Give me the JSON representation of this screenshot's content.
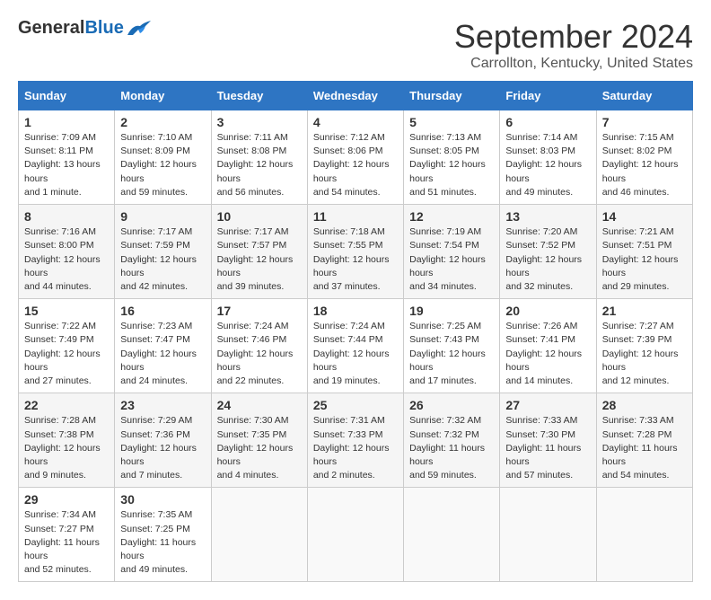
{
  "header": {
    "logo_general": "General",
    "logo_blue": "Blue",
    "title": "September 2024",
    "location": "Carrollton, Kentucky, United States"
  },
  "days_of_week": [
    "Sunday",
    "Monday",
    "Tuesday",
    "Wednesday",
    "Thursday",
    "Friday",
    "Saturday"
  ],
  "weeks": [
    [
      {
        "day": "1",
        "sunrise": "Sunrise: 7:09 AM",
        "sunset": "Sunset: 8:11 PM",
        "daylight": "Daylight: 13 hours and 1 minute."
      },
      {
        "day": "2",
        "sunrise": "Sunrise: 7:10 AM",
        "sunset": "Sunset: 8:09 PM",
        "daylight": "Daylight: 12 hours and 59 minutes."
      },
      {
        "day": "3",
        "sunrise": "Sunrise: 7:11 AM",
        "sunset": "Sunset: 8:08 PM",
        "daylight": "Daylight: 12 hours and 56 minutes."
      },
      {
        "day": "4",
        "sunrise": "Sunrise: 7:12 AM",
        "sunset": "Sunset: 8:06 PM",
        "daylight": "Daylight: 12 hours and 54 minutes."
      },
      {
        "day": "5",
        "sunrise": "Sunrise: 7:13 AM",
        "sunset": "Sunset: 8:05 PM",
        "daylight": "Daylight: 12 hours and 51 minutes."
      },
      {
        "day": "6",
        "sunrise": "Sunrise: 7:14 AM",
        "sunset": "Sunset: 8:03 PM",
        "daylight": "Daylight: 12 hours and 49 minutes."
      },
      {
        "day": "7",
        "sunrise": "Sunrise: 7:15 AM",
        "sunset": "Sunset: 8:02 PM",
        "daylight": "Daylight: 12 hours and 46 minutes."
      }
    ],
    [
      {
        "day": "8",
        "sunrise": "Sunrise: 7:16 AM",
        "sunset": "Sunset: 8:00 PM",
        "daylight": "Daylight: 12 hours and 44 minutes."
      },
      {
        "day": "9",
        "sunrise": "Sunrise: 7:17 AM",
        "sunset": "Sunset: 7:59 PM",
        "daylight": "Daylight: 12 hours and 42 minutes."
      },
      {
        "day": "10",
        "sunrise": "Sunrise: 7:17 AM",
        "sunset": "Sunset: 7:57 PM",
        "daylight": "Daylight: 12 hours and 39 minutes."
      },
      {
        "day": "11",
        "sunrise": "Sunrise: 7:18 AM",
        "sunset": "Sunset: 7:55 PM",
        "daylight": "Daylight: 12 hours and 37 minutes."
      },
      {
        "day": "12",
        "sunrise": "Sunrise: 7:19 AM",
        "sunset": "Sunset: 7:54 PM",
        "daylight": "Daylight: 12 hours and 34 minutes."
      },
      {
        "day": "13",
        "sunrise": "Sunrise: 7:20 AM",
        "sunset": "Sunset: 7:52 PM",
        "daylight": "Daylight: 12 hours and 32 minutes."
      },
      {
        "day": "14",
        "sunrise": "Sunrise: 7:21 AM",
        "sunset": "Sunset: 7:51 PM",
        "daylight": "Daylight: 12 hours and 29 minutes."
      }
    ],
    [
      {
        "day": "15",
        "sunrise": "Sunrise: 7:22 AM",
        "sunset": "Sunset: 7:49 PM",
        "daylight": "Daylight: 12 hours and 27 minutes."
      },
      {
        "day": "16",
        "sunrise": "Sunrise: 7:23 AM",
        "sunset": "Sunset: 7:47 PM",
        "daylight": "Daylight: 12 hours and 24 minutes."
      },
      {
        "day": "17",
        "sunrise": "Sunrise: 7:24 AM",
        "sunset": "Sunset: 7:46 PM",
        "daylight": "Daylight: 12 hours and 22 minutes."
      },
      {
        "day": "18",
        "sunrise": "Sunrise: 7:24 AM",
        "sunset": "Sunset: 7:44 PM",
        "daylight": "Daylight: 12 hours and 19 minutes."
      },
      {
        "day": "19",
        "sunrise": "Sunrise: 7:25 AM",
        "sunset": "Sunset: 7:43 PM",
        "daylight": "Daylight: 12 hours and 17 minutes."
      },
      {
        "day": "20",
        "sunrise": "Sunrise: 7:26 AM",
        "sunset": "Sunset: 7:41 PM",
        "daylight": "Daylight: 12 hours and 14 minutes."
      },
      {
        "day": "21",
        "sunrise": "Sunrise: 7:27 AM",
        "sunset": "Sunset: 7:39 PM",
        "daylight": "Daylight: 12 hours and 12 minutes."
      }
    ],
    [
      {
        "day": "22",
        "sunrise": "Sunrise: 7:28 AM",
        "sunset": "Sunset: 7:38 PM",
        "daylight": "Daylight: 12 hours and 9 minutes."
      },
      {
        "day": "23",
        "sunrise": "Sunrise: 7:29 AM",
        "sunset": "Sunset: 7:36 PM",
        "daylight": "Daylight: 12 hours and 7 minutes."
      },
      {
        "day": "24",
        "sunrise": "Sunrise: 7:30 AM",
        "sunset": "Sunset: 7:35 PM",
        "daylight": "Daylight: 12 hours and 4 minutes."
      },
      {
        "day": "25",
        "sunrise": "Sunrise: 7:31 AM",
        "sunset": "Sunset: 7:33 PM",
        "daylight": "Daylight: 12 hours and 2 minutes."
      },
      {
        "day": "26",
        "sunrise": "Sunrise: 7:32 AM",
        "sunset": "Sunset: 7:32 PM",
        "daylight": "Daylight: 11 hours and 59 minutes."
      },
      {
        "day": "27",
        "sunrise": "Sunrise: 7:33 AM",
        "sunset": "Sunset: 7:30 PM",
        "daylight": "Daylight: 11 hours and 57 minutes."
      },
      {
        "day": "28",
        "sunrise": "Sunrise: 7:33 AM",
        "sunset": "Sunset: 7:28 PM",
        "daylight": "Daylight: 11 hours and 54 minutes."
      }
    ],
    [
      {
        "day": "29",
        "sunrise": "Sunrise: 7:34 AM",
        "sunset": "Sunset: 7:27 PM",
        "daylight": "Daylight: 11 hours and 52 minutes."
      },
      {
        "day": "30",
        "sunrise": "Sunrise: 7:35 AM",
        "sunset": "Sunset: 7:25 PM",
        "daylight": "Daylight: 11 hours and 49 minutes."
      },
      null,
      null,
      null,
      null,
      null
    ]
  ]
}
